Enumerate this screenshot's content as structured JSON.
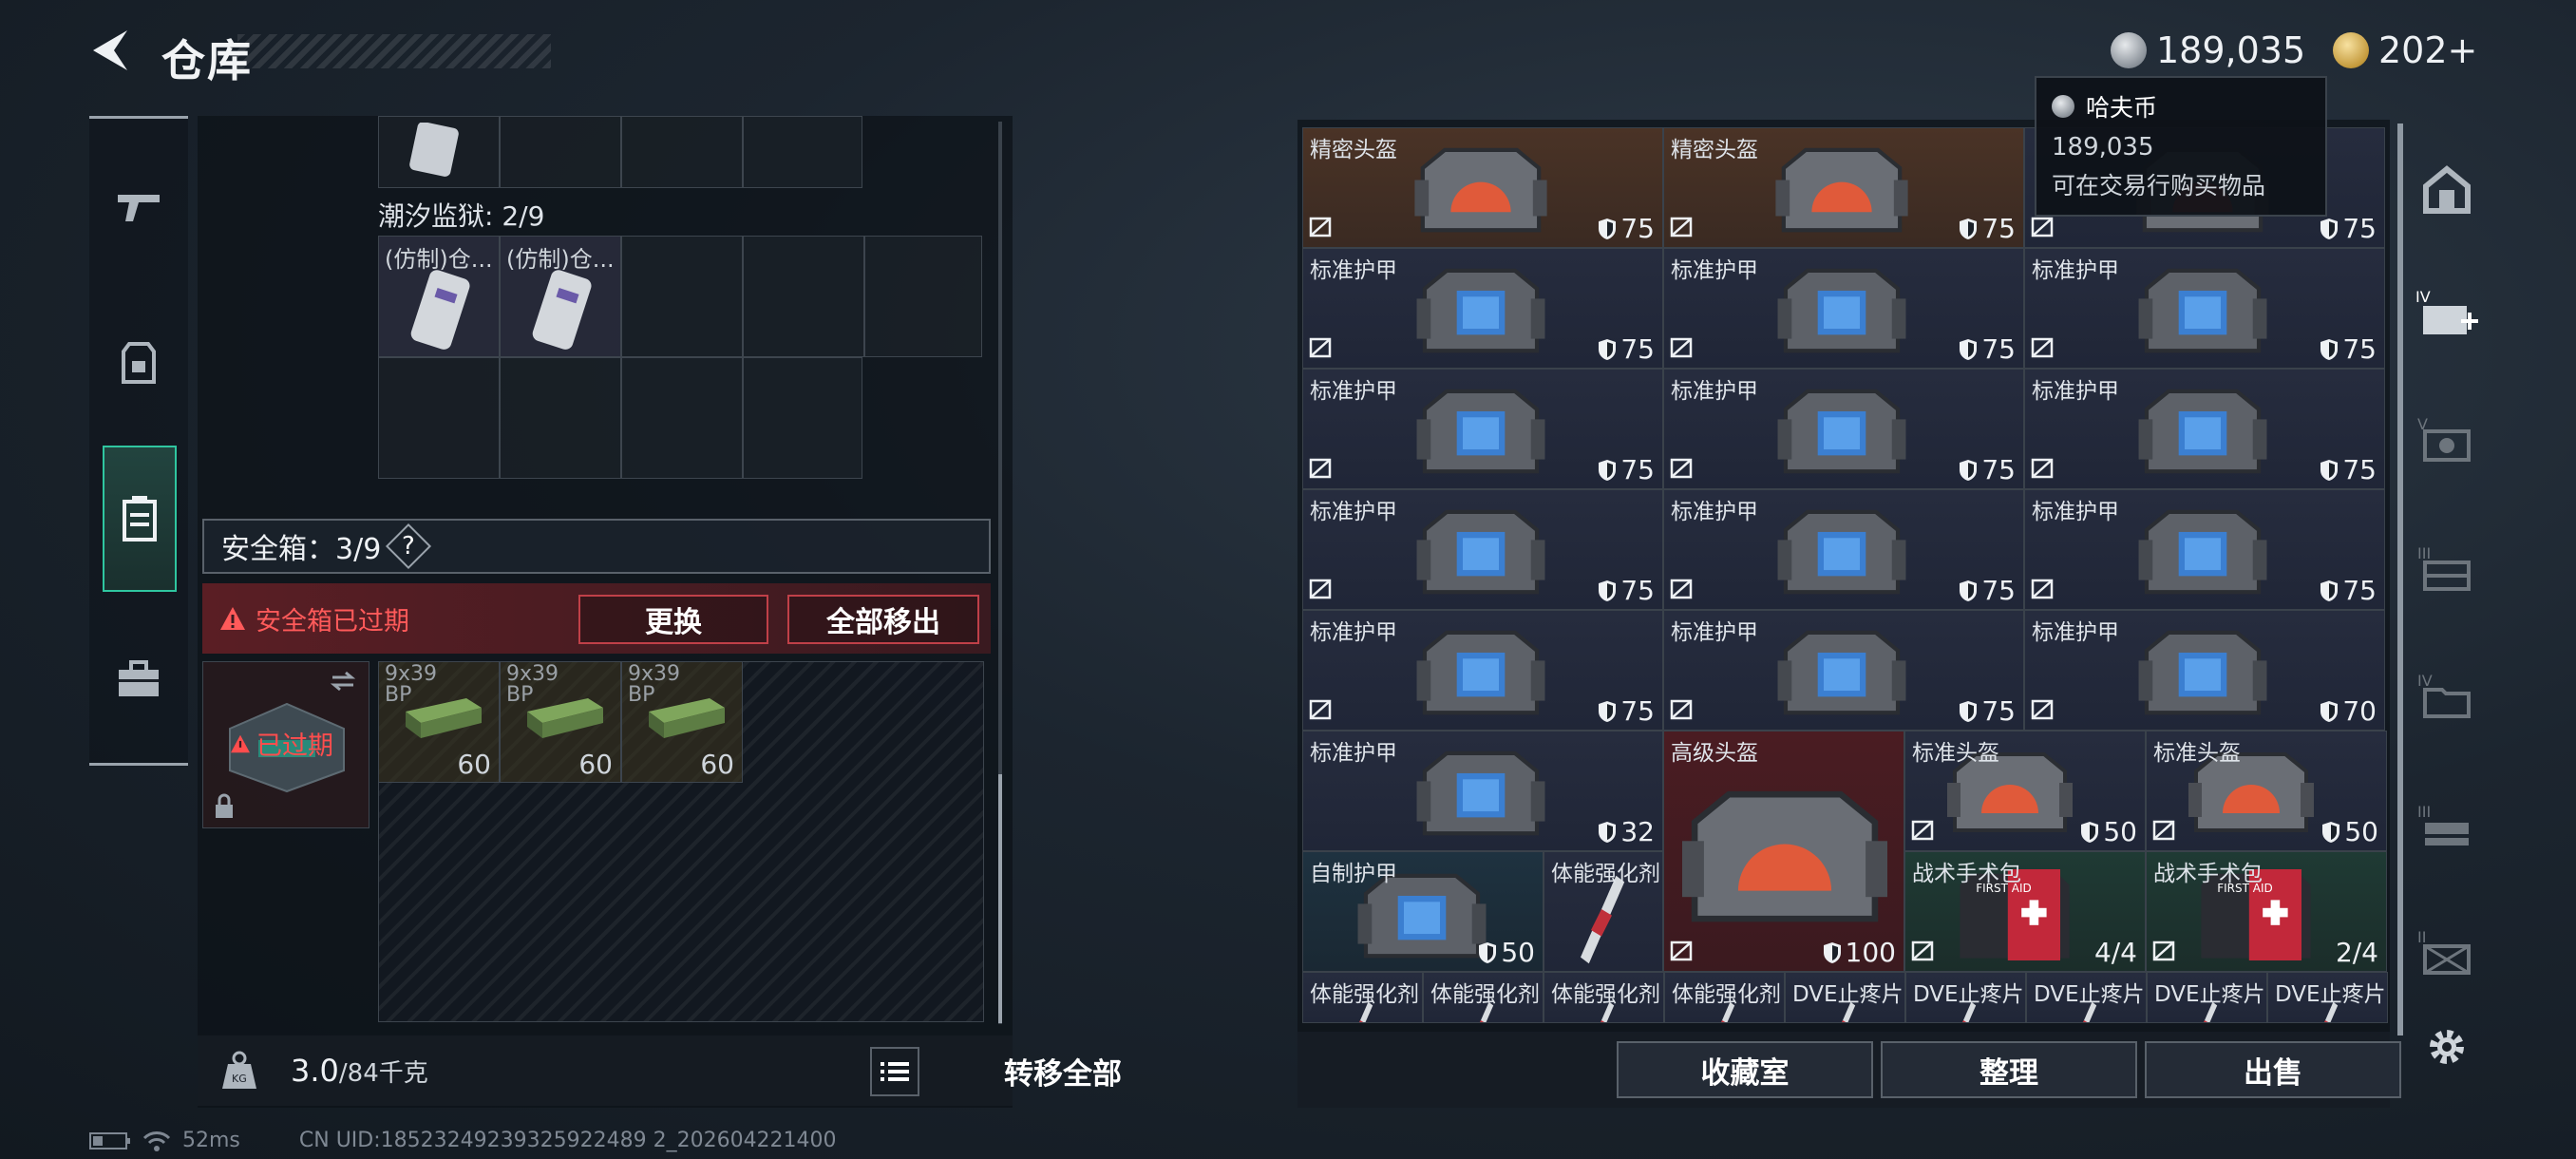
{
  "header": {
    "title": "仓库"
  },
  "currency": {
    "haf_coin": "189,035",
    "gold": "202+"
  },
  "tooltip": {
    "name": "哈夫币",
    "amount": "189,035",
    "desc": "可在交易行购买物品"
  },
  "left": {
    "prison_label": "潮汐监狱: 2/9",
    "prison_items": [
      "(仿制)仓...",
      "(仿制)仓..."
    ],
    "safebox_label": "安全箱：3/9",
    "help": "?",
    "warning": "安全箱已过期",
    "replace_btn": "更换",
    "remove_all_btn": "全部移出",
    "expired_tag": "已过期",
    "ammo": [
      {
        "label": "9x39\nBP",
        "count": "60"
      },
      {
        "label": "9x39\nBP",
        "count": "60"
      },
      {
        "label": "9x39\nBP",
        "count": "60"
      }
    ],
    "weight_value": "3.0",
    "weight_max": "/84千克",
    "transfer_btn": "转移全部"
  },
  "status": {
    "ping": "52ms",
    "uid": "CN UID:18523249239325922489 2_202604221400"
  },
  "grid": [
    {
      "name": "精密头盔",
      "val": "75",
      "bg": "brown",
      "type": "helmet"
    },
    {
      "name": "精密头盔",
      "val": "75",
      "bg": "brown",
      "type": "helmet"
    },
    {
      "name": "",
      "val": "75",
      "bg": "navy",
      "type": "helmet"
    },
    {
      "name": "标准护甲",
      "val": "75",
      "bg": "navy",
      "type": "vest"
    },
    {
      "name": "标准护甲",
      "val": "75",
      "bg": "navy",
      "type": "vest"
    },
    {
      "name": "标准护甲",
      "val": "75",
      "bg": "navy",
      "type": "vest"
    },
    {
      "name": "标准护甲",
      "val": "75",
      "bg": "navy",
      "type": "vest"
    },
    {
      "name": "标准护甲",
      "val": "75",
      "bg": "navy",
      "type": "vest"
    },
    {
      "name": "标准护甲",
      "val": "75",
      "bg": "navy",
      "type": "vest"
    },
    {
      "name": "标准护甲",
      "val": "75",
      "bg": "navy",
      "type": "vest"
    },
    {
      "name": "标准护甲",
      "val": "75",
      "bg": "navy",
      "type": "vest"
    },
    {
      "name": "标准护甲",
      "val": "75",
      "bg": "navy",
      "type": "vest"
    },
    {
      "name": "标准护甲",
      "val": "75",
      "bg": "navy",
      "type": "vest"
    },
    {
      "name": "标准护甲",
      "val": "75",
      "bg": "navy",
      "type": "vest"
    },
    {
      "name": "标准护甲",
      "val": "70",
      "bg": "navy",
      "type": "vest"
    }
  ],
  "row6": {
    "vest": {
      "name": "标准护甲",
      "val": "32"
    },
    "adv_helmet": {
      "name": "高级头盔",
      "val": "100"
    },
    "std_helmet1": {
      "name": "标准头盔",
      "val": "50"
    },
    "std_helmet2": {
      "name": "标准头盔",
      "val": "50"
    }
  },
  "row7": {
    "homemade": {
      "name": "自制护甲",
      "val": "50"
    },
    "stim": {
      "name": "体能强化剂"
    },
    "kit1": {
      "name": "战术手术包",
      "val": "4/4"
    },
    "kit2": {
      "name": "战术手术包",
      "val": "2/4"
    }
  },
  "row8": [
    "体能强化剂",
    "体能强化剂",
    "体能强化剂",
    "体能强化剂",
    "DVE止疼片",
    "DVE止疼片",
    "DVE止疼片",
    "DVE止疼片",
    "DVE止疼片"
  ],
  "buttons": {
    "collection": "收藏室",
    "sort": "整理",
    "sell": "出售"
  },
  "colors": {
    "accent": "#2fc6a0",
    "warning": "#ff4d4d",
    "brown": "#4a3326",
    "navy": "#262c3e"
  }
}
